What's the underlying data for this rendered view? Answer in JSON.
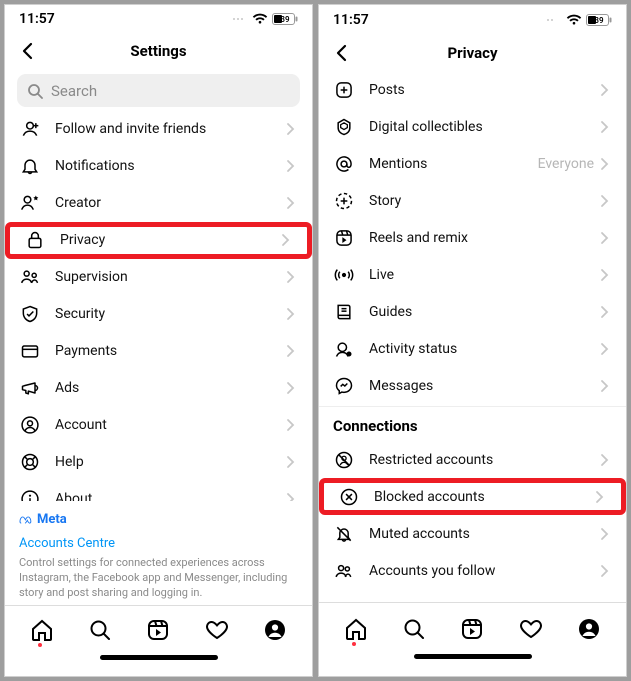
{
  "status": {
    "time": "11:57",
    "battery": "39"
  },
  "left": {
    "title": "Settings",
    "search_placeholder": "Search",
    "items": [
      {
        "icon": "add-person-icon",
        "label": "Follow and invite friends"
      },
      {
        "icon": "bell-icon",
        "label": "Notifications"
      },
      {
        "icon": "creator-icon",
        "label": "Creator"
      },
      {
        "icon": "lock-icon",
        "label": "Privacy",
        "highlight": true
      },
      {
        "icon": "supervision-icon",
        "label": "Supervision"
      },
      {
        "icon": "shield-icon",
        "label": "Security"
      },
      {
        "icon": "card-icon",
        "label": "Payments"
      },
      {
        "icon": "megaphone-icon",
        "label": "Ads"
      },
      {
        "icon": "user-circle-icon",
        "label": "Account"
      },
      {
        "icon": "lifebuoy-icon",
        "label": "Help"
      },
      {
        "icon": "info-icon",
        "label": "About"
      }
    ],
    "meta_brand": "Meta",
    "meta_link": "Accounts Centre",
    "meta_desc": "Control settings for connected experiences across Instagram, the Facebook app and Messenger, including story and post sharing and logging in."
  },
  "right": {
    "title": "Privacy",
    "items_a": [
      {
        "icon": "plus-square-icon",
        "label": "Posts"
      },
      {
        "icon": "hex-shield-icon",
        "label": "Digital collectibles"
      },
      {
        "icon": "at-icon",
        "label": "Mentions",
        "value": "Everyone"
      },
      {
        "icon": "story-plus-icon",
        "label": "Story"
      },
      {
        "icon": "reels-icon",
        "label": "Reels and remix"
      },
      {
        "icon": "live-icon",
        "label": "Live"
      },
      {
        "icon": "guides-icon",
        "label": "Guides"
      },
      {
        "icon": "activity-status-icon",
        "label": "Activity status"
      },
      {
        "icon": "messenger-icon",
        "label": "Messages"
      }
    ],
    "section_header": "Connections",
    "items_b": [
      {
        "icon": "restricted-icon",
        "label": "Restricted accounts"
      },
      {
        "icon": "blocked-icon",
        "label": "Blocked accounts",
        "highlight": true
      },
      {
        "icon": "muted-icon",
        "label": "Muted accounts"
      },
      {
        "icon": "accounts-follow-icon",
        "label": "Accounts you follow"
      }
    ]
  }
}
